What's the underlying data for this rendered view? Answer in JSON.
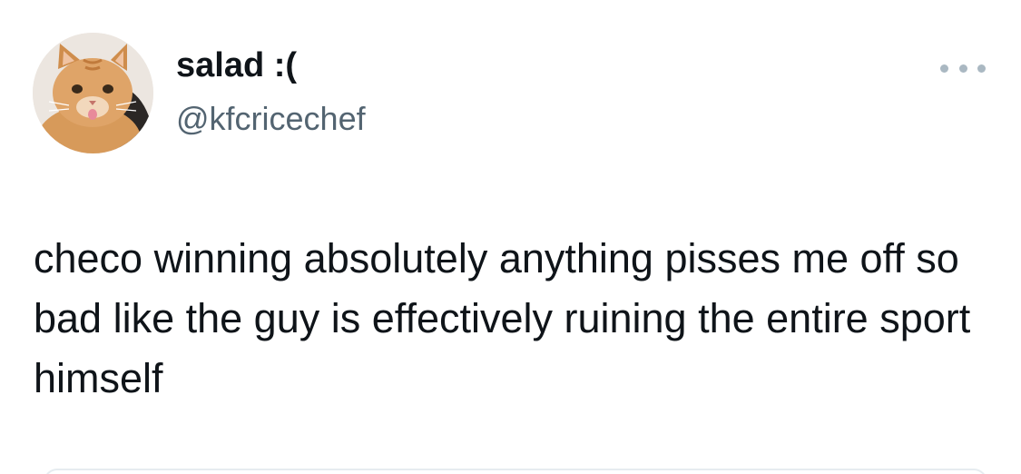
{
  "tweet": {
    "display_name": "salad :(",
    "handle": "@kfcricechef",
    "text": "checo winning absolutely anything pisses me off so bad like the guy is effectively ruining the entire sport himself",
    "avatar_icon": "cat-avatar",
    "more_icon": "more-options-icon"
  },
  "colors": {
    "text_primary": "#0f1419",
    "text_secondary": "#536471",
    "icon_muted": "#aab8c2",
    "background": "#ffffff"
  }
}
